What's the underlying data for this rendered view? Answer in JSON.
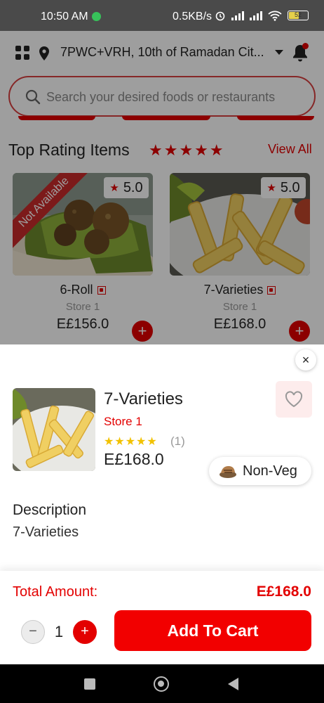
{
  "status_bar": {
    "time": "10:50 AM",
    "speed": "0.5KB/s",
    "battery": "52"
  },
  "header": {
    "location": "7PWC+VRH, 10th of Ramadan Cit..."
  },
  "search": {
    "placeholder": "Search your desired foods or restaurants"
  },
  "section": {
    "title": "Top Rating Items",
    "stars": "★★★★★",
    "view_all": "View All"
  },
  "cards": [
    {
      "rating": "5.0",
      "name": "6-Roll",
      "store": "Store 1",
      "price": "E£156.0",
      "badge": "Not Available"
    },
    {
      "rating": "5.0",
      "name": "7-Varieties",
      "store": "Store 1",
      "price": "E£168.0"
    }
  ],
  "product": {
    "name": "7-Varieties",
    "store": "Store 1",
    "stars": "★★★★★",
    "review_count": "(1)",
    "price": "E£168.0",
    "type": "Non-Veg",
    "description_title": "Description",
    "description": "7-Varieties"
  },
  "footer": {
    "total_label": "Total Amount:",
    "total_value": "E£168.0",
    "quantity": "1",
    "minus_label": "−",
    "plus_label": "+",
    "add_to_cart": "Add To Cart"
  },
  "close_label": "×",
  "colors": {
    "accent": "#e30000",
    "star_yellow": "#f2c200"
  }
}
